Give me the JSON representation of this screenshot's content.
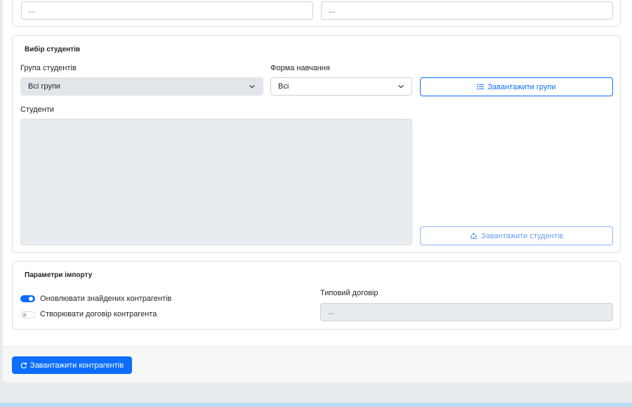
{
  "top_section": {
    "field_left_value": "...",
    "field_right_value": "..."
  },
  "students_section": {
    "heading": "Вибір студентів",
    "group_label": "Група студентів",
    "group_value": "Всі групи",
    "study_form_label": "Форма навчання",
    "study_form_value": "Всі",
    "load_groups_button": "Завантажити групи",
    "students_label": "Студенти",
    "load_students_button": "Завантажити студентів"
  },
  "import_section": {
    "heading": "Параметри імпорту",
    "toggle_update_label": "Оновлювати знайдених контрагентів",
    "toggle_update_on": true,
    "toggle_create_label": "Створювати договір контрагента",
    "toggle_create_on": false,
    "contract_label": "Типовий договір",
    "contract_value": "..."
  },
  "footer": {
    "load_contractors_button": "Завантажити контрагентів"
  },
  "colors": {
    "accent": "#0d6efd",
    "disabled_bg": "#e9ecef"
  }
}
